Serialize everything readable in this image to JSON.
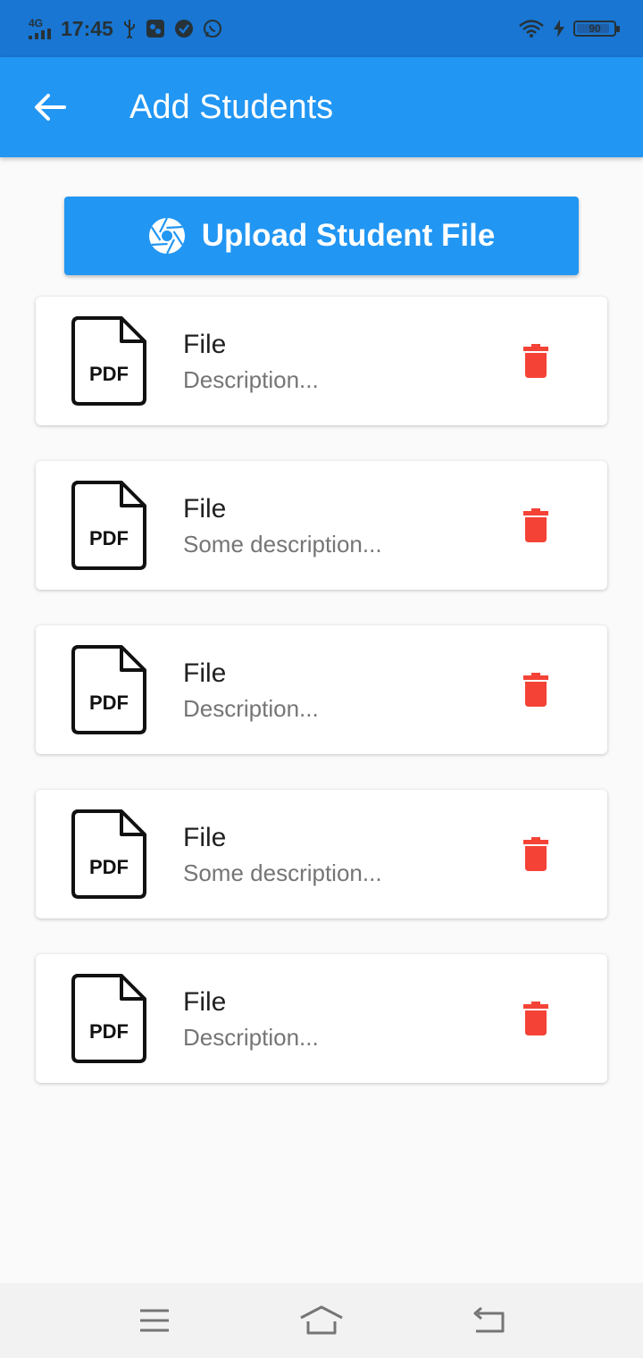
{
  "status_bar": {
    "network": "4G",
    "time": "17:45",
    "battery_level": "90",
    "battery_fraction": 0.9
  },
  "app_bar": {
    "title": "Add Students",
    "back_icon": "arrow-back-icon"
  },
  "upload_button": {
    "label": "Upload Student File",
    "icon": "camera-shutter-icon"
  },
  "files": [
    {
      "title": "File",
      "description": "Description...",
      "icon": "pdf-file-icon",
      "type_label": "PDF"
    },
    {
      "title": "File",
      "description": "Some description...",
      "icon": "pdf-file-icon",
      "type_label": "PDF"
    },
    {
      "title": "File",
      "description": "Description...",
      "icon": "pdf-file-icon",
      "type_label": "PDF"
    },
    {
      "title": "File",
      "description": "Some description...",
      "icon": "pdf-file-icon",
      "type_label": "PDF"
    },
    {
      "title": "File",
      "description": "Description...",
      "icon": "pdf-file-icon",
      "type_label": "PDF"
    }
  ],
  "colors": {
    "status_bar": "#1976d2",
    "primary": "#2196f3",
    "delete": "#f44336",
    "background": "#fafafa"
  },
  "nav_bar": {
    "items": [
      "menu-icon",
      "home-icon",
      "back-icon"
    ]
  }
}
